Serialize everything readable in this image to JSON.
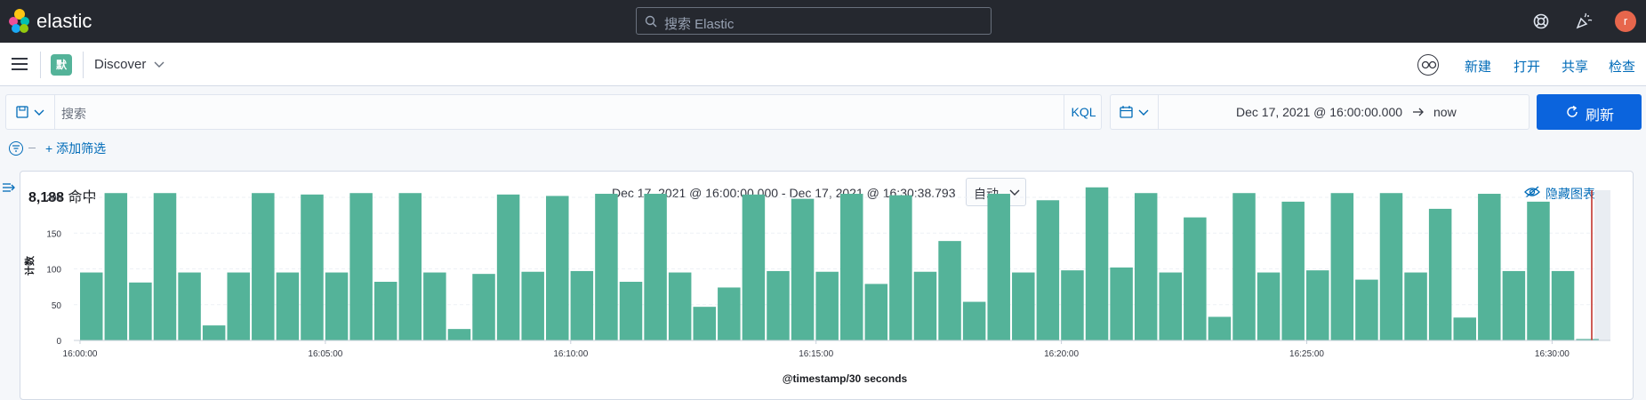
{
  "header": {
    "brand": "elastic",
    "search_placeholder": "搜索 Elastic",
    "avatar_initial": "r"
  },
  "nav": {
    "space_badge": "默",
    "breadcrumb": "Discover",
    "links": {
      "new": "新建",
      "open": "打开",
      "share": "共享",
      "inspect": "检查"
    }
  },
  "query": {
    "placeholder": "搜索",
    "language": "KQL"
  },
  "time": {
    "start": "Dec 17, 2021 @ 16:00:00.000",
    "end": "now",
    "refresh_label": "刷新"
  },
  "filters": {
    "add_label": "+ 添加筛选"
  },
  "histogram": {
    "hits_count": "8,188",
    "hits_label": "命中",
    "range_label": "Dec 17, 2021 @ 16:00:00.000 - Dec 17, 2021 @ 16:30:38.793",
    "interval": "自动",
    "hide_chart_label": "隐藏图表"
  },
  "chart_data": {
    "type": "bar",
    "xlabel": "@timestamp/30 seconds",
    "ylabel": "计数",
    "ylim": [
      0,
      210
    ],
    "yticks": [
      0,
      50,
      100,
      150,
      200
    ],
    "xticks": [
      "16:00:00",
      "16:05:00",
      "16:10:00",
      "16:15:00",
      "16:20:00",
      "16:25:00",
      "16:30:00"
    ],
    "bar_color": "#54b399",
    "values": [
      95,
      206,
      81,
      206,
      95,
      21,
      95,
      206,
      95,
      204,
      95,
      206,
      82,
      206,
      95,
      16,
      93,
      204,
      96,
      202,
      97,
      205,
      82,
      205,
      95,
      47,
      74,
      204,
      97,
      198,
      96,
      205,
      79,
      203,
      96,
      139,
      54,
      205,
      95,
      196,
      98,
      214,
      102,
      206,
      95,
      172,
      33,
      206,
      95,
      194,
      98,
      206,
      85,
      206,
      95,
      184,
      32,
      205,
      97,
      194,
      97,
      2
    ]
  }
}
